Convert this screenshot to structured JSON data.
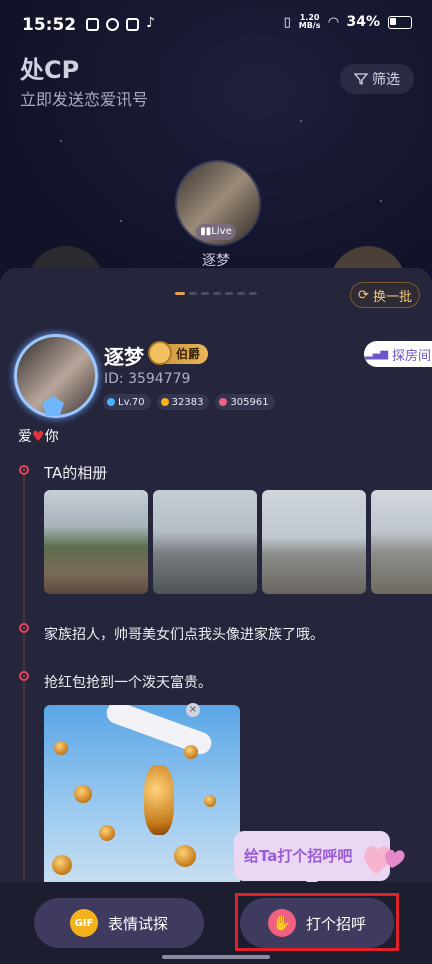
{
  "status": {
    "time": "15:52",
    "net_top": "1.20",
    "net_bottom": "MB/s",
    "battery": "34%"
  },
  "header": {
    "title": "处CP",
    "subtitle": "立即发送恋爱讯号",
    "filter_label": "筛选"
  },
  "carousel": {
    "live_badge": "Live",
    "center_name": "逐梦"
  },
  "card": {
    "refresh_label": "换一批",
    "room_label": "探房间",
    "name": "逐梦",
    "rank": "伯爵",
    "id": "ID: 3594779",
    "chips": {
      "level": "Lv.70",
      "coins": "32383",
      "hearts": "305961"
    },
    "bio_prefix": "爱",
    "bio_suffix": "你",
    "album_title": "TA的相册",
    "post1": "家族招人，帅哥美女们点我头像进家族了哦。",
    "post2": "抢红包抢到一个泼天富贵。"
  },
  "tooltip": "给Ta打个招呼吧",
  "actions": {
    "emoji_label": "表情试探",
    "greet_label": "打个招呼",
    "gif_icon_text": "GIF"
  },
  "colors": {
    "accent": "#e6425a",
    "gold": "#f2c77a",
    "purple": "#6e55c9"
  }
}
